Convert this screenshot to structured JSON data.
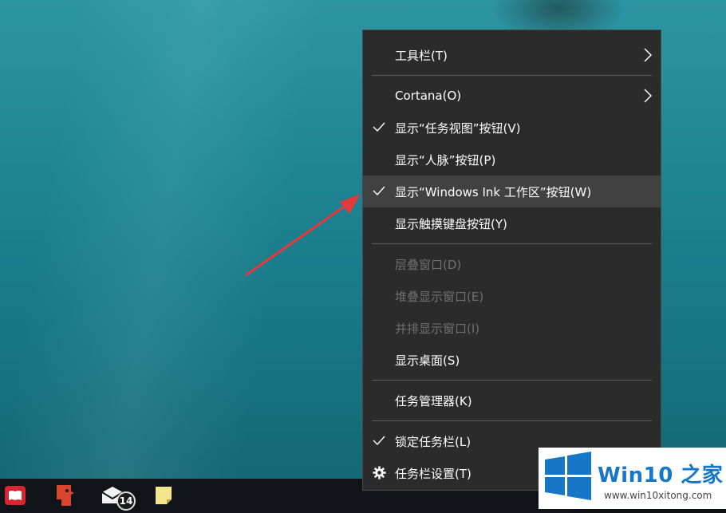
{
  "context_menu": {
    "items": [
      {
        "label": "工具栏(T)",
        "checked": false,
        "disabled": false,
        "submenu": true
      },
      {
        "label": "Cortana(O)",
        "checked": false,
        "disabled": false,
        "submenu": true
      },
      {
        "label": "显示“任务视图”按钮(V)",
        "checked": true,
        "disabled": false,
        "submenu": false
      },
      {
        "label": "显示“人脉”按钮(P)",
        "checked": false,
        "disabled": false,
        "submenu": false
      },
      {
        "label": "显示“Windows Ink 工作区”按钮(W)",
        "checked": true,
        "disabled": false,
        "submenu": false,
        "highlighted": true
      },
      {
        "label": "显示触摸键盘按钮(Y)",
        "checked": false,
        "disabled": false,
        "submenu": false
      },
      {
        "label": "层叠窗口(D)",
        "checked": false,
        "disabled": true,
        "submenu": false
      },
      {
        "label": "堆叠显示窗口(E)",
        "checked": false,
        "disabled": true,
        "submenu": false
      },
      {
        "label": "并排显示窗口(I)",
        "checked": false,
        "disabled": true,
        "submenu": false
      },
      {
        "label": "显示桌面(S)",
        "checked": false,
        "disabled": false,
        "submenu": false
      },
      {
        "label": "任务管理器(K)",
        "checked": false,
        "disabled": false,
        "submenu": false
      },
      {
        "label": "锁定任务栏(L)",
        "checked": true,
        "disabled": false,
        "submenu": false
      },
      {
        "label": "任务栏设置(T)",
        "checked": false,
        "disabled": false,
        "submenu": false,
        "icon": "gear-icon"
      }
    ]
  },
  "taskbar": {
    "icons": [
      "book-app-icon",
      "red-app-icon",
      "mail-icon",
      "sticky-notes-icon"
    ],
    "mail_badge": "14"
  },
  "watermark": {
    "title": "Win10 之家",
    "url": "www.win10xitong.com"
  },
  "colors": {
    "menu_bg": "#2b2b2b",
    "menu_hover": "#414141",
    "disabled_text": "#6f6f6f",
    "arrow": "#e5393b",
    "logo_blue": "#1677c9"
  }
}
